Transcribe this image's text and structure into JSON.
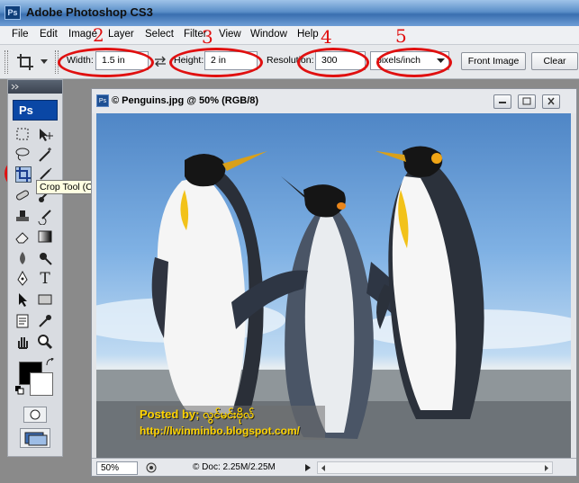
{
  "app": {
    "title": "Adobe Photoshop CS3",
    "logo": "Ps"
  },
  "menubar": [
    "File",
    "Edit",
    "Image",
    "Layer",
    "Select",
    "Filter",
    "View",
    "Window",
    "Help"
  ],
  "options": {
    "width_label": "Width:",
    "width_value": "1.5 in",
    "height_label": "Height:",
    "height_value": "2 in",
    "resolution_label": "Resolution:",
    "resolution_value": "300",
    "resolution_unit": "pixels/inch",
    "front_image_label": "Front Image",
    "clear_label": "Clear"
  },
  "annotations": [
    "1",
    "2",
    "3",
    "4",
    "5"
  ],
  "annotation_color": "#e01010",
  "tools": {
    "logo": "Ps",
    "tooltip": "Crop Tool (C)",
    "icons": [
      "marquee-icon",
      "move-icon",
      "lasso-icon",
      "magic-wand-icon",
      "crop-icon",
      "slice-icon",
      "healing-brush-icon",
      "brush-icon",
      "clone-stamp-icon",
      "history-brush-icon",
      "eraser-icon",
      "gradient-icon",
      "blur-icon",
      "dodge-icon",
      "pen-icon",
      "type-icon",
      "path-selection-icon",
      "rectangle-icon",
      "notes-icon",
      "eyedropper-icon",
      "hand-icon",
      "zoom-icon"
    ],
    "foreground_color": "#000000",
    "background_color": "#ffffff"
  },
  "document": {
    "title": "© Penguins.jpg @ 50% (RGB/8)",
    "zoom": "50%",
    "doc_info": "Doc: 2.25M/2.25M",
    "watermark_line1": "Posted by; လွင်မင်းဗိုလ်",
    "watermark_line2": "http://lwinminbo.blogspot.com/"
  }
}
